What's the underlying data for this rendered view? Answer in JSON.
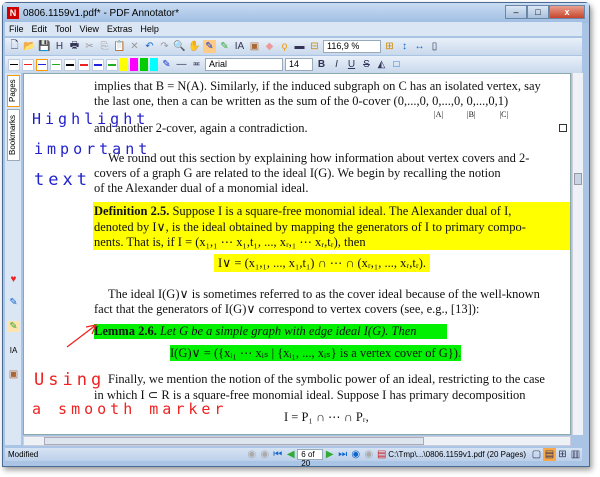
{
  "window": {
    "title": "0806.1159v1.pdf* - PDF Annotator*"
  },
  "menu": [
    "File",
    "Edit",
    "Tool",
    "View",
    "Extras",
    "Help"
  ],
  "toolbar": {
    "zoom": "116,9 %",
    "font": "Arial",
    "font_size": "14",
    "bold": "B",
    "italic": "I",
    "underline": "U",
    "strike": "S"
  },
  "sidebar": {
    "tabs": [
      "Pages",
      "Bookmarks"
    ]
  },
  "document": {
    "lines": [
      "implies that B = N(A). Similarly, if the induced subgraph on C has an isolated vertex, say",
      "the last one, then a can be written as the sum of the 0-cover (0,...,0, 0,...,0, 0,...,0,1)",
      "|A|     |B|     |C|",
      "and another 2-cover, again a contradiction.",
      "We round out this section by explaining how information about vertex covers and 2-",
      "covers of a graph G are related to the ideal I(G). We begin by recalling the notion",
      "of the Alexander dual of a monomial ideal."
    ],
    "def_title": "Definition 2.5.",
    "def_lines": [
      " Suppose I is a square-free monomial ideal. The Alexander dual of I,",
      "denoted by I∨, is the ideal obtained by mapping the generators of I to primary compo-",
      "nents. That is, if I = (x₁,₁ ⋯ x₁,t₁, ..., xᵣ,₁ ⋯ xᵣ,tᵣ), then"
    ],
    "def_eq": "I∨ = (x₁,₁, ..., x₁,t₁) ∩ ⋯ ∩ (xᵣ,₁, ..., xᵣ,tᵣ).",
    "para2": [
      "The ideal I(G)∨ is sometimes referred to as the cover ideal because of the well-known",
      "fact that the generators of I(G)∨ correspond to vertex covers (see, e.g., [13]):"
    ],
    "lemma_title": "Lemma 2.6.",
    "lemma_text": " Let G be a simple graph with edge ideal I(G). Then",
    "lemma_eq": "I(G)∨ = ({xᵢ₁ ⋯ xᵢₛ | {xᵢ₁, ..., xᵢₛ} is a vertex cover of G}).",
    "para3": [
      "Finally, we mention the notion of the symbolic power of an ideal, restricting to the case",
      "in which I ⊂ R is a square-free monomial ideal. Suppose I has primary decomposition"
    ],
    "eq3": "I = P₁ ∩ ⋯ ∩ Pᵣ,"
  },
  "annotations": {
    "blue": [
      "Highlight",
      "important",
      "text"
    ],
    "red": [
      "Using",
      "a smooth marker"
    ]
  },
  "status": {
    "state": "Modified",
    "page": "6 of 20",
    "file": "C:\\Tmp\\...\\0806.1159v1.pdf (20 Pages)"
  }
}
